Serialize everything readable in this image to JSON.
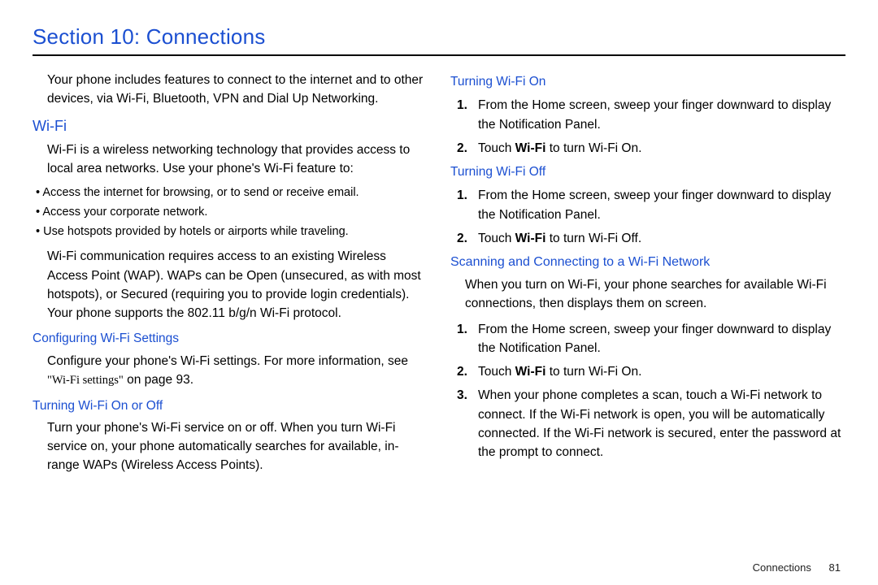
{
  "title": "Section 10: Connections",
  "intro": "Your phone includes features to connect to the internet and to other devices, via Wi-Fi, Bluetooth, VPN and Dial Up Networking.",
  "h_wifi": "Wi-Fi",
  "wifi_intro": "Wi-Fi is a wireless networking technology that provides access to local area networks. Use your phone's Wi-Fi feature to:",
  "wifi_bullets": [
    "Access the internet for browsing, or to send or receive email.",
    "Access your corporate network.",
    "Use hotspots provided by hotels or airports while traveling."
  ],
  "wifi_wap": "Wi-Fi communication requires access to an existing Wireless Access Point (WAP). WAPs can be Open (unsecured, as with most hotspots), or Secured (requiring you to provide login credentials). Your phone supports the 802.11 b/g/n Wi-Fi protocol.",
  "h_config": "Configuring Wi-Fi Settings",
  "config_text_pre": "Configure your phone's Wi-Fi settings. For more information, see ",
  "config_quote": "\"Wi-Fi settings\"",
  "config_text_post": " on page 93.",
  "h_onoff": "Turning Wi-Fi On or Off",
  "onoff_text": "Turn your phone's Wi-Fi service on or off. When you turn Wi-Fi service on, your phone automatically searches for available, in-range WAPs (Wireless Access Points).",
  "h_on": "Turning Wi-Fi On",
  "on_steps": {
    "s1": "From the Home screen, sweep your finger downward to display the Notification Panel.",
    "s2_pre": "Touch ",
    "s2_bold": "Wi-Fi",
    "s2_post": " to turn Wi-Fi On."
  },
  "h_off": "Turning Wi-Fi Off",
  "off_steps": {
    "s1": "From the Home screen, sweep your finger downward to display the Notification Panel.",
    "s2_pre": "Touch ",
    "s2_bold": "Wi-Fi",
    "s2_post": " to turn Wi-Fi Off."
  },
  "h_scan": "Scanning and Connecting to a Wi-Fi Network",
  "scan_intro": "When you turn on Wi-Fi, your phone searches for available Wi-Fi connections, then displays them on screen.",
  "scan_steps": {
    "s1": "From the Home screen, sweep your finger downward to display the Notification Panel.",
    "s2_pre": "Touch ",
    "s2_bold": "Wi-Fi",
    "s2_post": " to turn Wi-Fi On.",
    "s3": "When your phone completes a scan, touch a Wi-Fi network to connect. If the Wi-Fi network is open, you will be automatically connected. If the Wi-Fi network is secured, enter the password at the prompt to connect."
  },
  "footer_label": "Connections",
  "footer_page": "81",
  "numbers": {
    "n1": "1.",
    "n2": "2.",
    "n3": "3."
  }
}
